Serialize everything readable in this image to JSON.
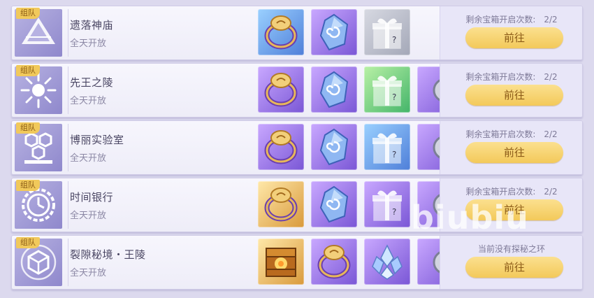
{
  "rows": [
    {
      "badge": "组队",
      "name": "遗落神庙",
      "hours": "全天开放",
      "icon": "pyramid-icon",
      "rewards": [
        {
          "icon": "ring-icon",
          "bg": "blue"
        },
        {
          "icon": "rune-stone-icon",
          "bg": "purple"
        },
        {
          "icon": "gift-box-icon",
          "bg": "grey"
        }
      ],
      "remain_label": "剩余宝箱开启次数:",
      "remain_count": "2/2",
      "button": "前往"
    },
    {
      "badge": "组队",
      "name": "先王之陵",
      "hours": "全天开放",
      "icon": "sun-icon",
      "rewards": [
        {
          "icon": "ring-icon",
          "bg": "purple"
        },
        {
          "icon": "rune-stone-icon",
          "bg": "purple"
        },
        {
          "icon": "gift-box-icon",
          "bg": "green"
        },
        {
          "icon": "partial-item-icon",
          "bg": "purple"
        }
      ],
      "remain_label": "剩余宝箱开启次数:",
      "remain_count": "2/2",
      "button": "前往"
    },
    {
      "badge": "组队",
      "name": "博丽实验室",
      "hours": "全天开放",
      "icon": "hexagon-lab-icon",
      "rewards": [
        {
          "icon": "ring-icon",
          "bg": "purple"
        },
        {
          "icon": "rune-stone-icon",
          "bg": "purple"
        },
        {
          "icon": "gift-box-icon",
          "bg": "blue"
        },
        {
          "icon": "partial-item-icon",
          "bg": "purple"
        }
      ],
      "remain_label": "剩余宝箱开启次数:",
      "remain_count": "2/2",
      "button": "前往"
    },
    {
      "badge": "组队",
      "name": "时间银行",
      "hours": "全天开放",
      "icon": "clock-icon",
      "rewards": [
        {
          "icon": "ring-icon",
          "bg": "gold"
        },
        {
          "icon": "rune-stone-icon",
          "bg": "purple"
        },
        {
          "icon": "gift-box-icon",
          "bg": "purple"
        },
        {
          "icon": "partial-item-icon",
          "bg": "purple"
        }
      ],
      "remain_label": "剩余宝箱开启次数:",
      "remain_count": "2/2",
      "button": "前往"
    },
    {
      "badge": "组队",
      "name": "裂隙秘境・王陵",
      "hours": "全天开放",
      "icon": "cube-icon",
      "rewards": [
        {
          "icon": "treasure-chest-icon",
          "bg": "gold"
        },
        {
          "icon": "ring-icon",
          "bg": "purple"
        },
        {
          "icon": "crystal-cluster-icon",
          "bg": "purple"
        },
        {
          "icon": "partial-item-icon",
          "bg": "purple"
        }
      ],
      "remain_label": "当前没有探秘之环",
      "remain_count": "",
      "button": "前往"
    }
  ],
  "watermark": "biubiu",
  "colors": {
    "badge": "#f1c95b",
    "button": "#f3c95a",
    "icon_bg": "#8f88cc"
  }
}
